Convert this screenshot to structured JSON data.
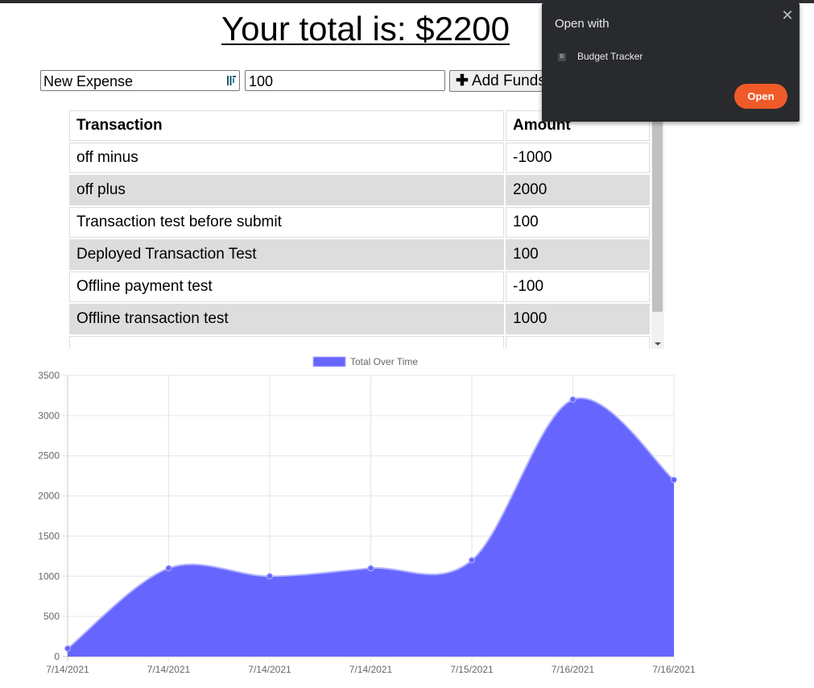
{
  "header": {
    "total_label": "Your total is: ",
    "total_value": "$2200"
  },
  "form": {
    "name_value": "New Expense",
    "amount_value": "100",
    "add_funds_label": "Add Funds"
  },
  "table": {
    "headers": [
      "Transaction",
      "Amount"
    ],
    "rows": [
      {
        "name": "off minus",
        "amount": "-1000"
      },
      {
        "name": "off plus",
        "amount": "2000"
      },
      {
        "name": "Transaction test before submit",
        "amount": "100"
      },
      {
        "name": "Deployed Transaction Test",
        "amount": "100"
      },
      {
        "name": "Offline payment test",
        "amount": "-100"
      },
      {
        "name": "Offline transaction test",
        "amount": "1000"
      }
    ]
  },
  "popup": {
    "title": "Open with",
    "app_name": "Budget Tracker",
    "app_icon_letter": "B",
    "open_label": "Open"
  },
  "colors": {
    "fill": "#6666ff",
    "stroke": "#b3b3ff",
    "open_button": "#f05a28",
    "popup_bg": "#292a2d"
  },
  "chart_data": {
    "type": "area",
    "x": [
      "7/14/2021",
      "7/14/2021",
      "7/14/2021",
      "7/14/2021",
      "7/15/2021",
      "7/16/2021",
      "7/16/2021"
    ],
    "series": [
      {
        "name": "Total Over Time",
        "values": [
          100,
          1100,
          1000,
          1100,
          1200,
          3200,
          2200
        ]
      }
    ],
    "ylim": [
      0,
      3500
    ],
    "yticks": [
      0,
      500,
      1000,
      1500,
      2000,
      2500,
      3000,
      3500
    ],
    "grid": true,
    "legend": "top",
    "smooth": true
  }
}
